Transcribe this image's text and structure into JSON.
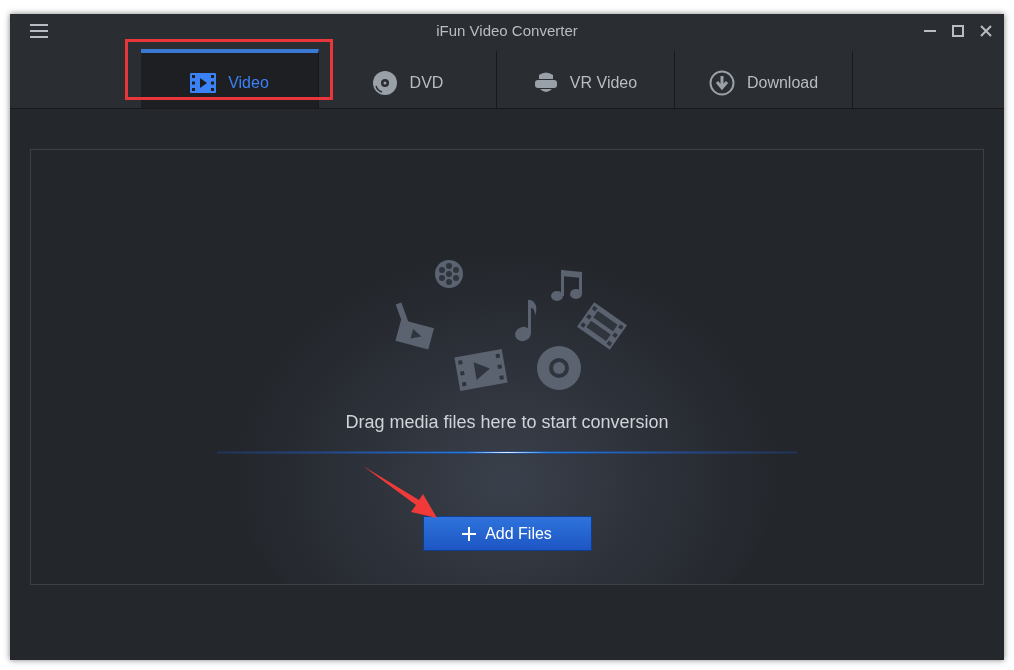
{
  "window": {
    "title": "iFun Video Converter"
  },
  "tabs": [
    {
      "label": "Video",
      "kind": "video",
      "selected": true
    },
    {
      "label": "DVD",
      "kind": "disc",
      "selected": false
    },
    {
      "label": "VR Video",
      "kind": "vr",
      "selected": false
    },
    {
      "label": "Download",
      "kind": "download",
      "selected": false
    }
  ],
  "drop_zone": {
    "message": "Drag media files here to start conversion",
    "button": "Add Files"
  }
}
